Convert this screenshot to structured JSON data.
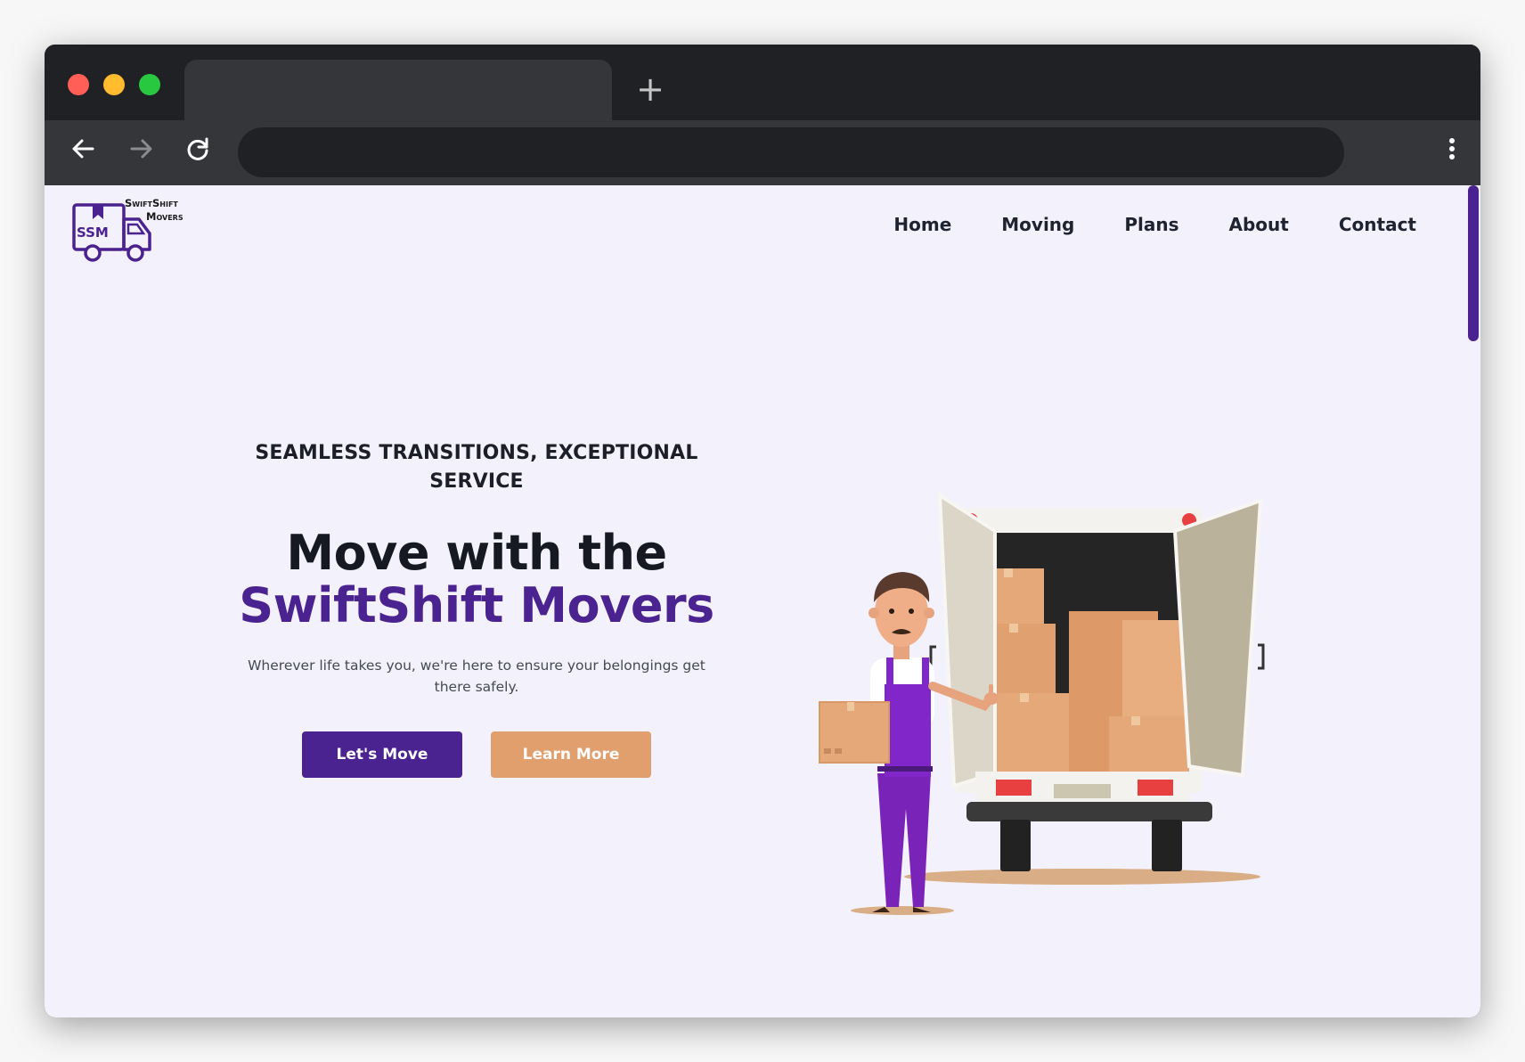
{
  "browser": {
    "new_tab_symbol": "+",
    "url": ""
  },
  "site": {
    "logo": {
      "mark": "SSM",
      "name_line1": "SwiftShift",
      "name_line2": "Movers"
    },
    "nav": [
      "Home",
      "Moving",
      "Plans",
      "About",
      "Contact"
    ]
  },
  "hero": {
    "eyebrow": "SEAMLESS TRANSITIONS, EXCEPTIONAL SERVICE",
    "headline_line1": "Move with the",
    "headline_line2": "SwiftShift Movers",
    "subtitle": "Wherever life takes you, we're here to ensure your belongings get there safely.",
    "primary_button": "Let's Move",
    "secondary_button": "Learn More"
  },
  "colors": {
    "brand_purple": "#4b2391",
    "accent_orange": "#e19f6e",
    "page_background": "#f3f1fb"
  },
  "icons": [
    "back-arrow-icon",
    "forward-arrow-icon",
    "reload-icon",
    "more-vert-icon",
    "truck-logo-icon"
  ]
}
